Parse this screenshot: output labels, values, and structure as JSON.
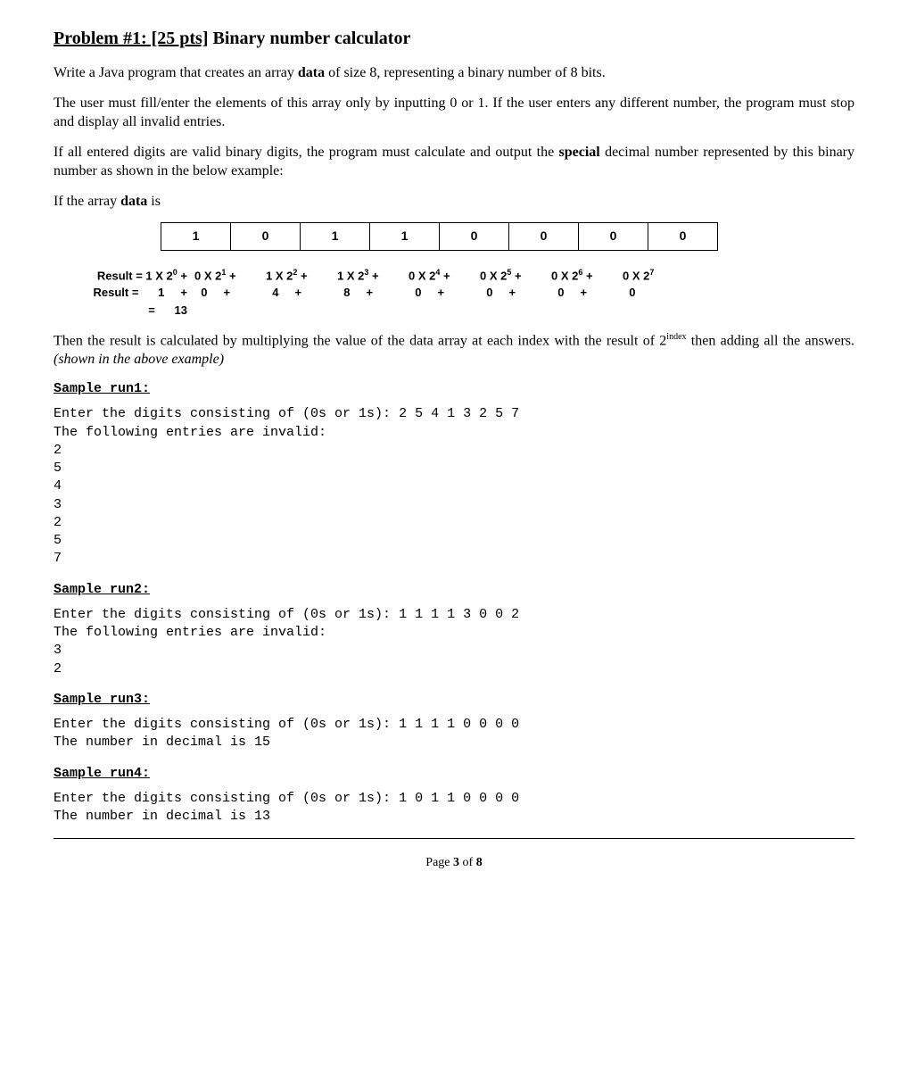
{
  "title_part1": "Problem #1:",
  "title_part2": " [25 pts]",
  "title_part3": " Binary number calculator",
  "para1_a": "Write a Java program that creates an array ",
  "para1_b": "data",
  "para1_c": " of size 8, representing a binary number of 8 bits.",
  "para2": "The user must fill/enter the elements of this array only by inputting 0 or 1. If the user enters any different number, the program must stop and display all invalid entries.",
  "para3_a": "If all entered digits are valid binary digits, the program must calculate and output the ",
  "para3_b": "special",
  "para3_c": " decimal number represented by this binary number as shown in the below example:",
  "para4_a": "If the array ",
  "para4_b": "data",
  "para4_c": " is",
  "array_cells": [
    "1",
    "0",
    "1",
    "1",
    "0",
    "0",
    "0",
    "0"
  ],
  "calc_result_label": "Result = ",
  "calc_row1": [
    "1 X 2⁰ +",
    "0 X 2¹ +",
    "1 X 2² +",
    "1 X 2³ +",
    "0 X 2⁴ +",
    "0 X 2⁵ +",
    "0 X 2⁶ +",
    "0 X 2⁷"
  ],
  "calc_row2_label": "Result =",
  "calc_row2": [
    "1    +",
    "0    +",
    "4    +",
    "8    +",
    "0    +",
    "0    +",
    "0    +",
    "0"
  ],
  "calc_row3_label": "=",
  "calc_row3_val": "13",
  "para5_a": "Then the result is calculated by multiplying the value of the data array at each index with the result of 2",
  "para5_sup": "index",
  "para5_b": " then adding all the answers. ",
  "para5_c": "(shown in the above example)",
  "sample1_heading": "Sample run1:",
  "sample1_text": "Enter the digits consisting of (0s or 1s): 2 5 4 1 3 2 5 7\nThe following entries are invalid:\n2\n5\n4\n3\n2\n5\n7",
  "sample2_heading": "Sample run2:",
  "sample2_text": "Enter the digits consisting of (0s or 1s): 1 1 1 1 3 0 0 2\nThe following entries are invalid:\n3\n2",
  "sample3_heading": "Sample run3:",
  "sample3_text": "Enter the digits consisting of (0s or 1s): 1 1 1 1 0 0 0 0\nThe number in decimal is 15",
  "sample4_heading": "Sample run4:",
  "sample4_text": "Enter the digits consisting of (0s or 1s): 1 0 1 1 0 0 0 0\nThe number in decimal is 13",
  "footer_page": "Page ",
  "footer_num": "3",
  "footer_of": " of ",
  "footer_total": "8"
}
